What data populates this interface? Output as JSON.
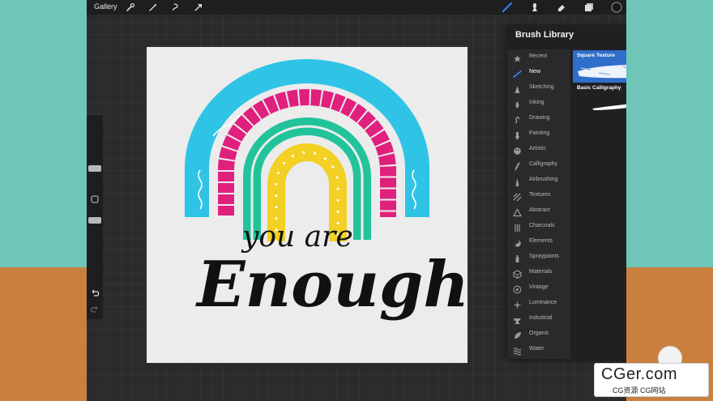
{
  "topbar": {
    "gallery_label": "Gallery",
    "tools": [
      "wrench-icon",
      "magic-wand-icon",
      "selection-icon",
      "transform-arrow-icon",
      "brush-icon",
      "smudge-icon",
      "eraser-icon",
      "layers-icon",
      "color-swatch"
    ],
    "accent_color": "#2f8cff",
    "active_color": "#1a1a1a"
  },
  "brush_library": {
    "title": "Brush Library",
    "add_label": "+",
    "categories": [
      {
        "label": "Recent",
        "icon": "star-icon"
      },
      {
        "label": "New",
        "icon": "brush-stroke-icon"
      },
      {
        "label": "Sketching",
        "icon": "pencil-tip-icon"
      },
      {
        "label": "Inking",
        "icon": "ink-drop-icon"
      },
      {
        "label": "Drawing",
        "icon": "squiggle-icon"
      },
      {
        "label": "Painting",
        "icon": "paint-brush-icon"
      },
      {
        "label": "Artistic",
        "icon": "palette-icon"
      },
      {
        "label": "Calligraphy",
        "icon": "calligraphy-icon"
      },
      {
        "label": "Airbrushing",
        "icon": "airbrush-icon"
      },
      {
        "label": "Textures",
        "icon": "texture-icon"
      },
      {
        "label": "Abstract",
        "icon": "triangle-icon"
      },
      {
        "label": "Charcoals",
        "icon": "charcoal-icon"
      },
      {
        "label": "Elements",
        "icon": "yin-yang-icon"
      },
      {
        "label": "Spraypaints",
        "icon": "spray-can-icon"
      },
      {
        "label": "Materials",
        "icon": "cube-icon"
      },
      {
        "label": "Vintage",
        "icon": "vintage-star-icon"
      },
      {
        "label": "Luminance",
        "icon": "sparkle-icon"
      },
      {
        "label": "Industrial",
        "icon": "anvil-icon"
      },
      {
        "label": "Organic",
        "icon": "leaf-icon"
      },
      {
        "label": "Water",
        "icon": "waves-icon"
      }
    ],
    "brushes": [
      {
        "name": "Square Texture",
        "selected": true
      },
      {
        "name": "Basic Calligraphy",
        "selected": false
      }
    ]
  },
  "canvas": {
    "line1": "you are",
    "line2": "Enough",
    "colors": {
      "cyan": "#2fc4e6",
      "magenta": "#e0207d",
      "green": "#22c39b",
      "yellow": "#f2d024"
    }
  },
  "watermark": {
    "main": "CGer.com",
    "sub": "CG资源 CG网站"
  }
}
